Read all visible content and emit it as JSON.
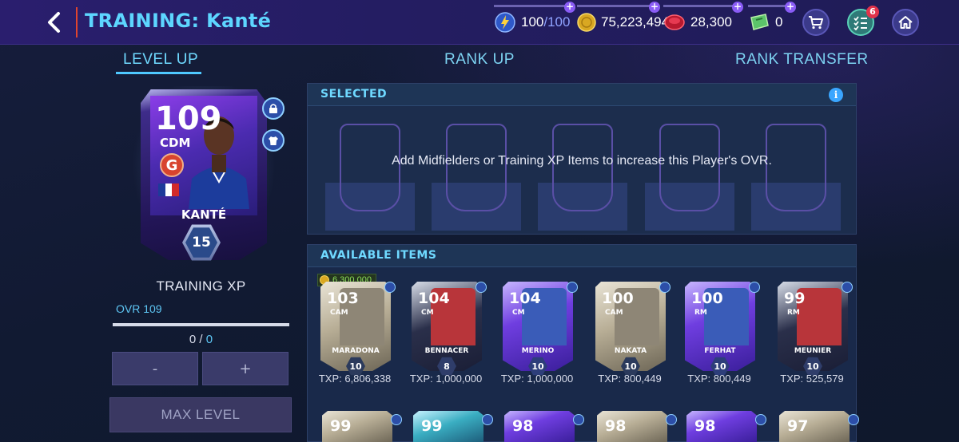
{
  "header": {
    "title": "TRAINING: Kanté",
    "resources": {
      "energy_value": "100",
      "energy_max": "/100",
      "coins": "75,223,494",
      "gems": "28,300",
      "tickets": "0"
    },
    "notifications_count": "6"
  },
  "tabs": [
    {
      "label": "LEVEL UP"
    },
    {
      "label": "RANK UP"
    },
    {
      "label": "RANK TRANSFER"
    }
  ],
  "player": {
    "ovr": "109",
    "position": "CDM",
    "program_letter": "G",
    "name": "KANTÉ",
    "rank": "15",
    "flag_colors": [
      "#1e3a9a",
      "#ffffff",
      "#d22a2a"
    ]
  },
  "training": {
    "title": "TRAINING XP",
    "ovr_label": "OVR 109",
    "xp_current": "0",
    "xp_sep": " / ",
    "xp_total": "0",
    "progress": 0,
    "minus_label": "-",
    "plus_label": "+",
    "max_level_label": "MAX LEVEL"
  },
  "selected": {
    "heading": "SELECTED",
    "info_label": "i",
    "message": "Add Midfielders or Training XP Items to increase this Player's OVR."
  },
  "available": {
    "heading": "AVAILABLE ITEMS",
    "price": "6,300,000",
    "items": [
      {
        "ovr": "103",
        "pos": "CAM",
        "name": "MARADONA",
        "rank": "10",
        "txp": "TXP: 6,806,338",
        "theme": "icon"
      },
      {
        "ovr": "104",
        "pos": "CM",
        "name": "BENNACER",
        "rank": "8",
        "txp": "TXP: 1,000,000",
        "theme": "euro"
      },
      {
        "ovr": "104",
        "pos": "CM",
        "name": "MERINO",
        "rank": "10",
        "txp": "TXP: 1,000,000",
        "theme": "purple"
      },
      {
        "ovr": "100",
        "pos": "CAM",
        "name": "NAKATA",
        "rank": "10",
        "txp": "TXP: 800,449",
        "theme": "icon"
      },
      {
        "ovr": "100",
        "pos": "RM",
        "name": "FERHAT",
        "rank": "10",
        "txp": "TXP: 800,449",
        "theme": "purple"
      },
      {
        "ovr": "99",
        "pos": "RM",
        "name": "MEUNIER",
        "rank": "10",
        "txp": "TXP: 525,579",
        "theme": "euro"
      }
    ],
    "row2": [
      {
        "ovr": "99",
        "theme": "icon"
      },
      {
        "ovr": "99",
        "theme": "teal"
      },
      {
        "ovr": "98",
        "theme": "purple"
      },
      {
        "ovr": "98",
        "theme": "icon"
      },
      {
        "ovr": "98",
        "theme": "purple"
      },
      {
        "ovr": "97",
        "theme": "icon"
      }
    ]
  },
  "colors": {
    "accent": "#6fd9ff",
    "background": "#121a33",
    "topbar": "#241d62"
  }
}
